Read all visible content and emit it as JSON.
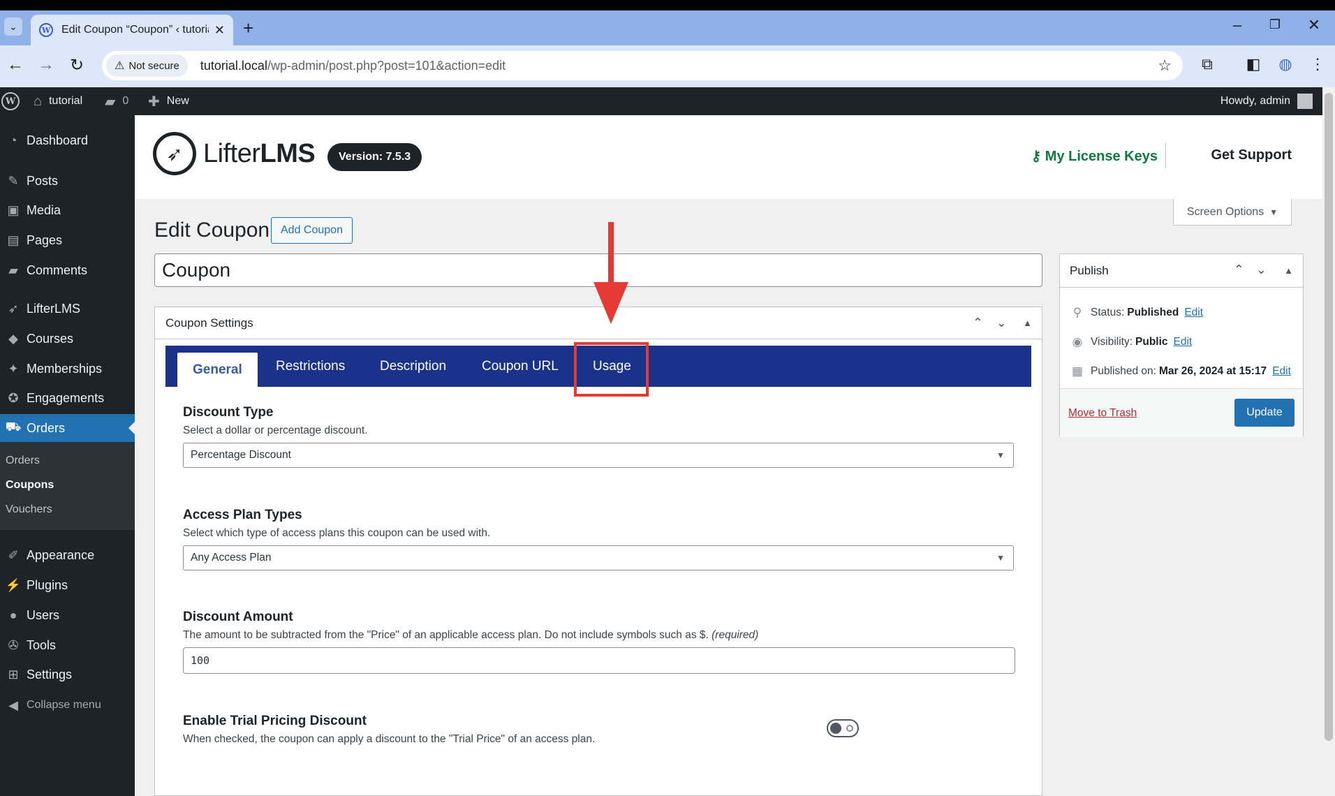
{
  "browser": {
    "tab_title": "Edit Coupon “Coupon” ‹ tutoria",
    "security_label": "Not secure",
    "url_host": "tutorial.local",
    "url_path": "/wp-admin/post.php?post=101&action=edit"
  },
  "adminbar": {
    "site_name": "tutorial",
    "comments_count": "0",
    "new_label": "New",
    "howdy": "Howdy, admin"
  },
  "sidebar": {
    "items": [
      {
        "label": "Dashboard",
        "icon": "dashboard-icon"
      },
      {
        "label": "Posts",
        "icon": "pin-icon"
      },
      {
        "label": "Media",
        "icon": "media-icon"
      },
      {
        "label": "Pages",
        "icon": "pages-icon"
      },
      {
        "label": "Comments",
        "icon": "comment-icon"
      },
      {
        "label": "LifterLMS",
        "icon": "rocket-icon"
      },
      {
        "label": "Courses",
        "icon": "graduation-cap-icon"
      },
      {
        "label": "Memberships",
        "icon": "group-icon"
      },
      {
        "label": "Engagements",
        "icon": "award-icon"
      },
      {
        "label": "Orders",
        "icon": "cart-icon"
      },
      {
        "label": "Appearance",
        "icon": "paintbrush-icon"
      },
      {
        "label": "Plugins",
        "icon": "plugin-icon"
      },
      {
        "label": "Users",
        "icon": "user-icon"
      },
      {
        "label": "Tools",
        "icon": "wrench-icon"
      },
      {
        "label": "Settings",
        "icon": "settings-icon"
      }
    ],
    "submenu": [
      "Orders",
      "Coupons",
      "Vouchers"
    ],
    "collapse_label": "Collapse menu"
  },
  "header": {
    "brand_light": "Lifter",
    "brand_bold": "LMS",
    "version": "Version: 7.5.3",
    "license_link": "My License Keys",
    "support_link": "Get Support"
  },
  "screen_options": "Screen Options",
  "page": {
    "title": "Edit Coupon",
    "add_button": "Add Coupon",
    "post_title": "Coupon"
  },
  "coupon_settings": {
    "heading": "Coupon Settings",
    "tabs": [
      "General",
      "Restrictions",
      "Description",
      "Coupon URL",
      "Usage"
    ],
    "fields": {
      "discount_type": {
        "label": "Discount Type",
        "desc": "Select a dollar or percentage discount.",
        "value": "Percentage Discount"
      },
      "access_plan_types": {
        "label": "Access Plan Types",
        "desc": "Select which type of access plans this coupon can be used with.",
        "value": "Any Access Plan"
      },
      "discount_amount": {
        "label": "Discount Amount",
        "desc": "The amount to be subtracted from the \"Price\" of an applicable access plan. Do not include symbols such as $.",
        "required": "(required)",
        "value": "100"
      },
      "trial_discount": {
        "label": "Enable Trial Pricing Discount",
        "desc": "When checked, the coupon can apply a discount to the \"Trial Price\" of an access plan.",
        "enabled": false
      }
    }
  },
  "publish": {
    "heading": "Publish",
    "status_label": "Status:",
    "status_value": "Published",
    "visibility_label": "Visibility:",
    "visibility_value": "Public",
    "published_label": "Published on:",
    "published_value": "Mar 26, 2024 at 15:17",
    "edit": "Edit",
    "trash": "Move to Trash",
    "update": "Update"
  },
  "colors": {
    "tab_bar": "#1a3289",
    "admin_bar": "#1d2327",
    "current_menu": "#2271b1",
    "annotation": "#e53935"
  }
}
